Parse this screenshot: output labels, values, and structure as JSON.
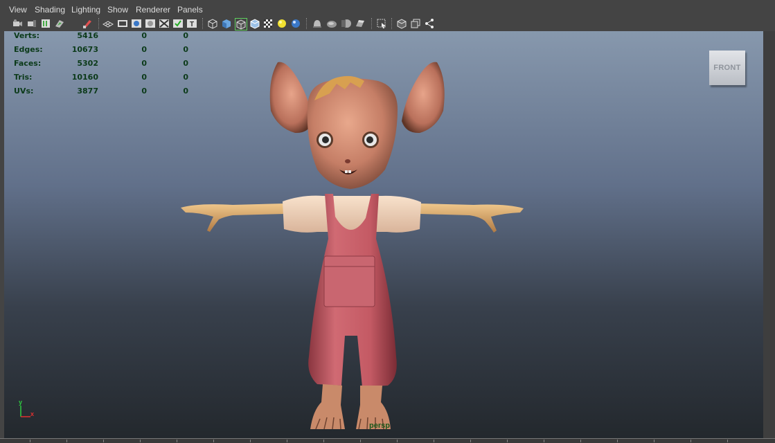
{
  "menubar": {
    "items": [
      "View",
      "Shading",
      "Lighting",
      "Show",
      "Renderer",
      "Panels"
    ]
  },
  "toolbar": {
    "icons": [
      "camera-select-icon",
      "camera-attributes-icon",
      "bookmark-icon",
      "image-plane-icon",
      "2d-pan-zoom-icon",
      "grid-icon",
      "film-gate-icon",
      "resolution-gate-icon",
      "gate-mask-icon",
      "field-chart-icon",
      "safe-action-icon",
      "safe-title-icon",
      "wireframe-icon",
      "smooth-shade-icon",
      "wireframe-on-shaded-icon",
      "xray-icon",
      "textured-icon",
      "default-lighting-icon",
      "all-lights-icon",
      "shadows-icon",
      "ambient-occlusion-icon",
      "motion-blur-icon",
      "anti-aliasing-icon",
      "select-camera-icon",
      "isolate-select-icon",
      "xray-joints-icon",
      "hud-toggle-icon"
    ]
  },
  "hud": {
    "rows": [
      {
        "label": "Verts:",
        "v1": "5416",
        "v2": "0",
        "v3": "0"
      },
      {
        "label": "Edges:",
        "v1": "10673",
        "v2": "0",
        "v3": "0"
      },
      {
        "label": "Faces:",
        "v1": "5302",
        "v2": "0",
        "v3": "0"
      },
      {
        "label": "Tris:",
        "v1": "10160",
        "v2": "0",
        "v3": "0"
      },
      {
        "label": "UVs:",
        "v1": "3877",
        "v2": "0",
        "v3": "0"
      }
    ]
  },
  "viewcube": {
    "label": "FRONT"
  },
  "axis": {
    "y": "y",
    "x": "x"
  },
  "camera": {
    "label": "persp"
  },
  "colors": {
    "hud_text": "#0b3a19",
    "viewport_top": "#8798ad",
    "viewport_bottom": "#23282d",
    "overalls": "#c85a64",
    "skin": "#cf8a72"
  }
}
